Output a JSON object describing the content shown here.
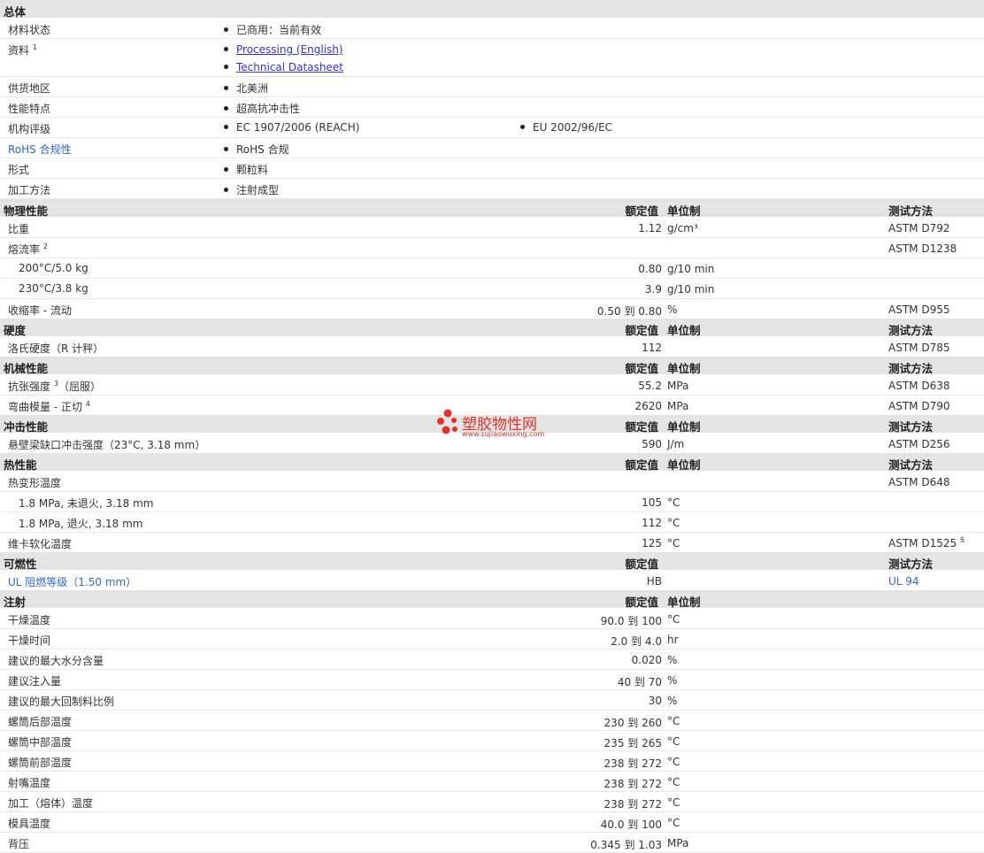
{
  "general": {
    "title": "总体",
    "status_label": "材料状态",
    "status_value": "已商用：当前有效",
    "docs_label": "资料",
    "docs_sup": "1",
    "doc1": "Processing (English)",
    "doc2": "Technical Datasheet",
    "region_label": "供货地区",
    "region_value": "北美洲",
    "feature_label": "性能特点",
    "feature_value": "超高抗冲击性",
    "agency_label": "机构评级",
    "agency1": "EC 1907/2006 (REACH)",
    "agency2": "EU 2002/96/EC",
    "rohs_label": "RoHS 合规性",
    "rohs_value": "RoHS 合规",
    "form_label": "形式",
    "form_value": "颗粒料",
    "method_label": "加工方法",
    "method_value": "注射成型"
  },
  "headers": {
    "nominal": "额定值",
    "unit": "单位制",
    "test": "测试方法"
  },
  "physical": {
    "title": "物理性能",
    "sg_label": "比重",
    "sg_val": "1.12",
    "sg_unit": "g/cm³",
    "sg_test": "ASTM D792",
    "mfr_label": "熔流率",
    "mfr_sup": "2",
    "mfr_test": "ASTM D1238",
    "mfr1_label": "200°C/5.0 kg",
    "mfr1_val": "0.80",
    "mfr1_unit": "g/10 min",
    "mfr2_label": "230°C/3.8 kg",
    "mfr2_val": "3.9",
    "mfr2_unit": "g/10 min",
    "shrink_label": "收缩率  - 流动",
    "shrink_val": "0.50 到  0.80",
    "shrink_unit": "%",
    "shrink_test": "ASTM D955"
  },
  "hardness": {
    "title": "硬度",
    "r_label": "洛氏硬度（R 计秤）",
    "r_val": "112",
    "r_test": "ASTM D785"
  },
  "mechanical": {
    "title": "机械性能",
    "ts_label": "抗张强度",
    "ts_sup": "3",
    "ts_label2": "（屈服）",
    "ts_val": "55.2",
    "ts_unit": "MPa",
    "ts_test": "ASTM D638",
    "fm_label": "弯曲模量  - 正切",
    "fm_sup": "4",
    "fm_val": "2620",
    "fm_unit": "MPa",
    "fm_test": "ASTM D790"
  },
  "impact": {
    "title": "冲击性能",
    "iz_label": "悬壁梁缺口冲击强度（23°C, 3.18 mm）",
    "iz_val": "590",
    "iz_unit": "J/m",
    "iz_test": "ASTM D256"
  },
  "thermal": {
    "title": "热性能",
    "hdt_label": "热变形温度",
    "hdt_test": "ASTM D648",
    "hdt1_label": "1.8 MPa, 未退火, 3.18 mm",
    "hdt1_val": "105",
    "hdt1_unit": "°C",
    "hdt2_label": "1.8 MPa, 退火, 3.18 mm",
    "hdt2_val": "112",
    "hdt2_unit": "°C",
    "vicat_label": "维卡软化温度",
    "vicat_val": "125",
    "vicat_unit": "°C",
    "vicat_test": "ASTM D1525",
    "vicat_sup": "5"
  },
  "flammability": {
    "title": "可燃性",
    "ul_label": "UL 阻燃等级（1.50 mm）",
    "ul_val": "HB",
    "ul_test": "UL 94"
  },
  "injection": {
    "title": "注射",
    "rows": [
      {
        "label": "干燥温度",
        "val": "90.0 到  100",
        "unit": "°C"
      },
      {
        "label": "干燥时间",
        "val": "2.0 到  4.0",
        "unit": "hr"
      },
      {
        "label": "建议的最大水分含量",
        "val": "0.020",
        "unit": "%"
      },
      {
        "label": "建议注入量",
        "val": "40 到  70",
        "unit": "%"
      },
      {
        "label": "建议的最大回制料比例",
        "val": "30",
        "unit": "%"
      },
      {
        "label": "螺筒后部温度",
        "val": "230 到  260",
        "unit": "°C"
      },
      {
        "label": "螺筒中部温度",
        "val": "235 到  265",
        "unit": "°C"
      },
      {
        "label": "螺筒前部温度",
        "val": "238 到  272",
        "unit": "°C"
      },
      {
        "label": "射嘴温度",
        "val": "238 到  272",
        "unit": "°C"
      },
      {
        "label": "加工（熔体）温度",
        "val": "238 到  272",
        "unit": "°C"
      },
      {
        "label": "模具温度",
        "val": "40.0 到  100",
        "unit": "°C"
      },
      {
        "label": "背压",
        "val": "0.345 到  1.03",
        "unit": "MPa"
      }
    ]
  },
  "watermark": {
    "name": "塑胶物性网",
    "url": "www.sujiaowuxing.com"
  }
}
